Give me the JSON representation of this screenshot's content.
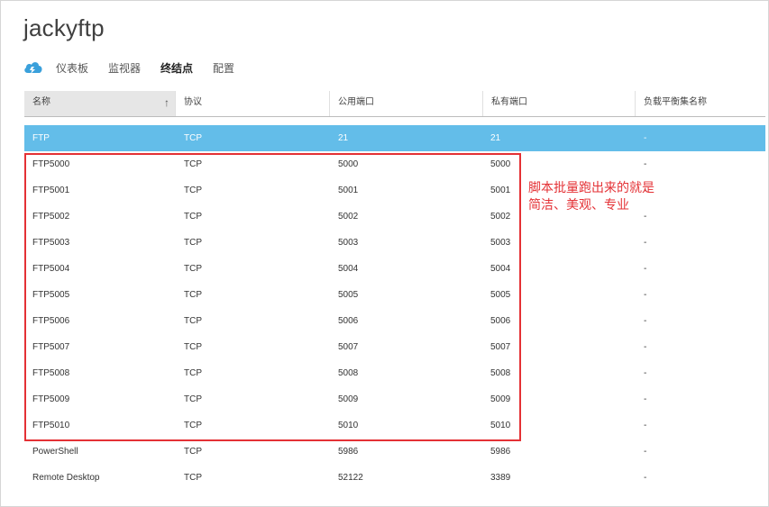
{
  "app": {
    "title": "jackyftp"
  },
  "nav": {
    "icon": "azure-cloud-icon",
    "tabs": [
      {
        "label": "仪表板",
        "active": false
      },
      {
        "label": "监视器",
        "active": false
      },
      {
        "label": "终结点",
        "active": true
      },
      {
        "label": "配置",
        "active": false
      }
    ]
  },
  "table": {
    "columns": [
      "名称",
      "协议",
      "公用端口",
      "私有端口",
      "负载平衡集名称"
    ],
    "sort_icon": "arrow-up-icon",
    "rows": [
      [
        "FTP",
        "TCP",
        "21",
        "21",
        "-"
      ],
      [
        "FTP5000",
        "TCP",
        "5000",
        "5000",
        "-"
      ],
      [
        "FTP5001",
        "TCP",
        "5001",
        "5001",
        "-"
      ],
      [
        "FTP5002",
        "TCP",
        "5002",
        "5002",
        "-"
      ],
      [
        "FTP5003",
        "TCP",
        "5003",
        "5003",
        "-"
      ],
      [
        "FTP5004",
        "TCP",
        "5004",
        "5004",
        "-"
      ],
      [
        "FTP5005",
        "TCP",
        "5005",
        "5005",
        "-"
      ],
      [
        "FTP5006",
        "TCP",
        "5006",
        "5006",
        "-"
      ],
      [
        "FTP5007",
        "TCP",
        "5007",
        "5007",
        "-"
      ],
      [
        "FTP5008",
        "TCP",
        "5008",
        "5008",
        "-"
      ],
      [
        "FTP5009",
        "TCP",
        "5009",
        "5009",
        "-"
      ],
      [
        "FTP5010",
        "TCP",
        "5010",
        "5010",
        "-"
      ],
      [
        "PowerShell",
        "TCP",
        "5986",
        "5986",
        "-"
      ],
      [
        "Remote Desktop",
        "TCP",
        "52122",
        "3389",
        "-"
      ]
    ]
  },
  "annotation": {
    "line1": "脚本批量跑出来的就是",
    "line2": "简洁、美观、专业",
    "color": "#e43135"
  },
  "colors": {
    "selected_row": "#63bde9",
    "accent": "#3aa0db"
  }
}
